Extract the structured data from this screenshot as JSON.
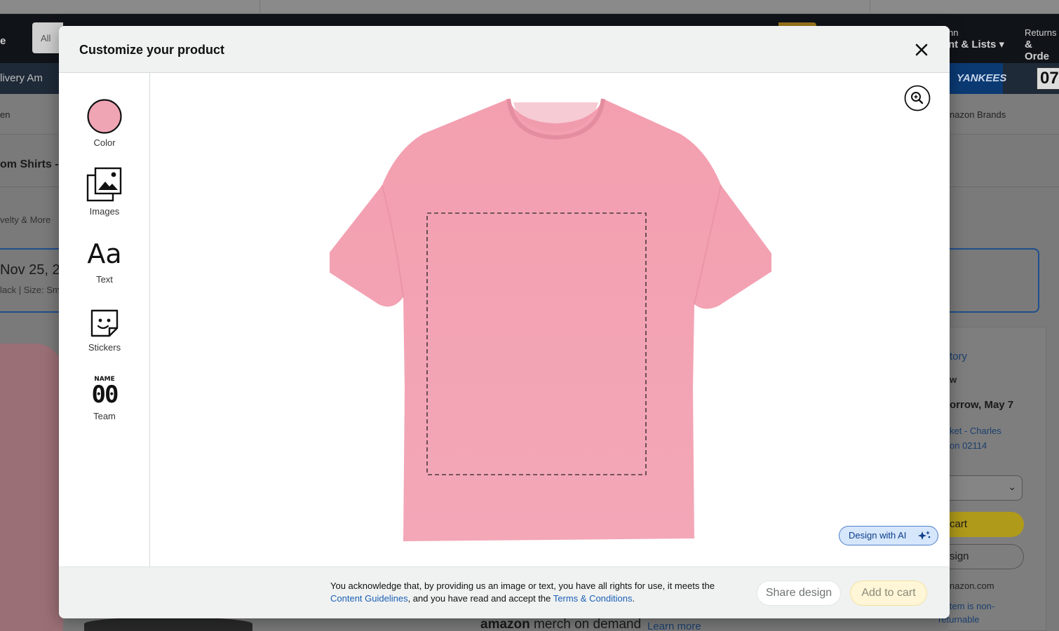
{
  "background": {
    "search_scope": "All",
    "nav_left": "e",
    "account_line1": "hn",
    "account_line2": "nt & Lists",
    "returns_line1": "Returns",
    "returns_line2": "& Orde",
    "subnav_left": "livery   Am",
    "yankees": "YANKEES",
    "score": "07",
    "crumb_left": "en",
    "crumb_right": "nazon Brands",
    "title_partial": "om Shirts -",
    "novelty": "velty & More",
    "date_partial": "Nov 25, 2",
    "date_sub": "lack | Size: Sm",
    "story": "tory",
    "w": "w",
    "tomorrow": "orrow, May 7",
    "loc1": "ket - Charles",
    "loc2": "on 02114",
    "cart": "cart",
    "sign": "sign",
    "amazon_com": "nazon.com",
    "returnable1": "is item is non-",
    "returnable2": "returnable",
    "merch_brand": "amazon",
    "merch_rest": " merch on demand",
    "learn_more": "Learn more"
  },
  "modal": {
    "title": "Customize your product",
    "close_icon": "close-icon",
    "tools": [
      {
        "label": "Color",
        "icon": "color-swatch-icon",
        "color": "#f0a5b4"
      },
      {
        "label": "Images",
        "icon": "images-icon"
      },
      {
        "label": "Text",
        "icon": "text-icon",
        "glyph": "Aa"
      },
      {
        "label": "Stickers",
        "icon": "sticker-icon"
      },
      {
        "label": "Team",
        "icon": "team-jersey-icon",
        "glyph_top": "NAME",
        "glyph_num": "00"
      }
    ],
    "zoom_icon": "zoom-in-icon",
    "shirt_color": "#f4a6b6",
    "ai_button": "Design with AI",
    "footer": {
      "ack_1": "You acknowledge that, by providing us an image or text, you have all rights for use, it meets the ",
      "content_guidelines": "Content Guidelines",
      "ack_2": ", and you have read and accept the ",
      "terms": "Terms & Conditions",
      "ack_3": ".",
      "share": "Share design",
      "add_to_cart": "Add to cart"
    }
  },
  "colors": {
    "link": "#1a5fb4",
    "ai_bg": "#d6e6fb",
    "cart_bg": "#fef6d6"
  }
}
